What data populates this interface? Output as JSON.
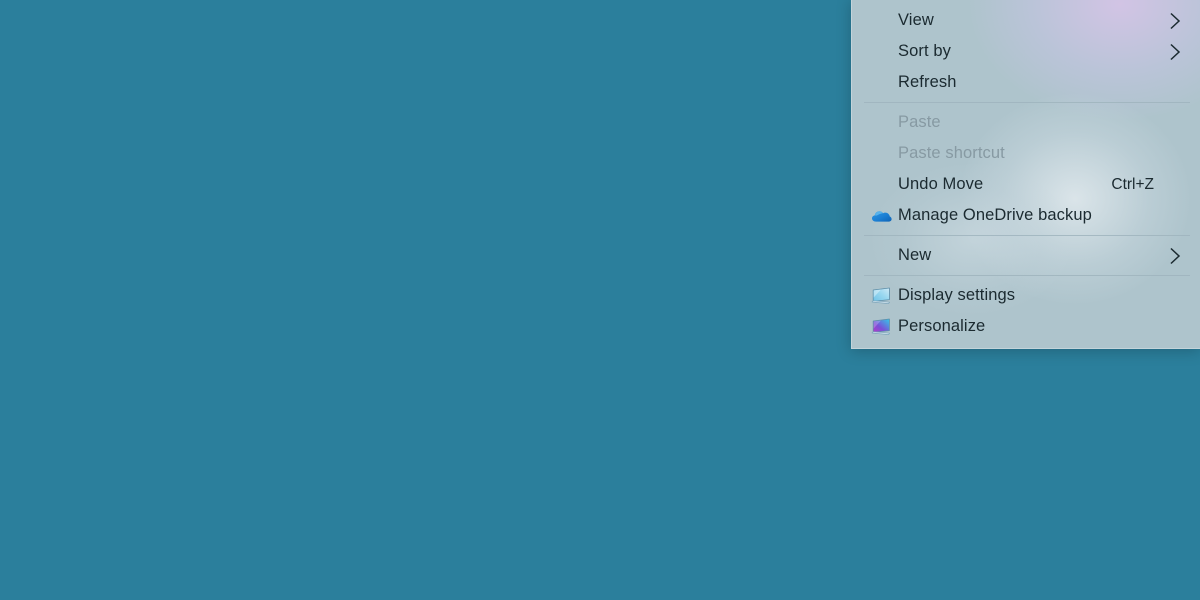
{
  "desktop": {
    "background_color": "#2b7f9c",
    "name": "windows-desktop"
  },
  "context_menu": {
    "background_color": "#aec4cc",
    "border_color": "#c3d4da",
    "text_color": "#1b2a30",
    "disabled_text_color": "#879aa3",
    "separator_color": "#9fb4bd",
    "groups": [
      {
        "items": [
          {
            "label": "View",
            "icon": "none",
            "accel": "",
            "submenu": true,
            "disabled": false
          },
          {
            "label": "Sort by",
            "icon": "none",
            "accel": "",
            "submenu": true,
            "disabled": false
          },
          {
            "label": "Refresh",
            "icon": "none",
            "accel": "",
            "submenu": false,
            "disabled": false
          }
        ]
      },
      {
        "items": [
          {
            "label": "Paste",
            "icon": "none",
            "accel": "",
            "submenu": false,
            "disabled": true
          },
          {
            "label": "Paste shortcut",
            "icon": "none",
            "accel": "",
            "submenu": false,
            "disabled": true
          },
          {
            "label": "Undo Move",
            "icon": "none",
            "accel": "Ctrl+Z",
            "submenu": false,
            "disabled": false
          },
          {
            "label": "Manage OneDrive backup",
            "icon": "onedrive-cloud-icon",
            "accel": "",
            "submenu": false,
            "disabled": false
          }
        ]
      },
      {
        "items": [
          {
            "label": "New",
            "icon": "none",
            "accel": "",
            "submenu": true,
            "disabled": false
          }
        ]
      },
      {
        "items": [
          {
            "label": "Display settings",
            "icon": "monitor-icon",
            "accel": "",
            "submenu": false,
            "disabled": false
          },
          {
            "label": "Personalize",
            "icon": "personalize-icon",
            "accel": "",
            "submenu": false,
            "disabled": false
          }
        ]
      }
    ]
  }
}
